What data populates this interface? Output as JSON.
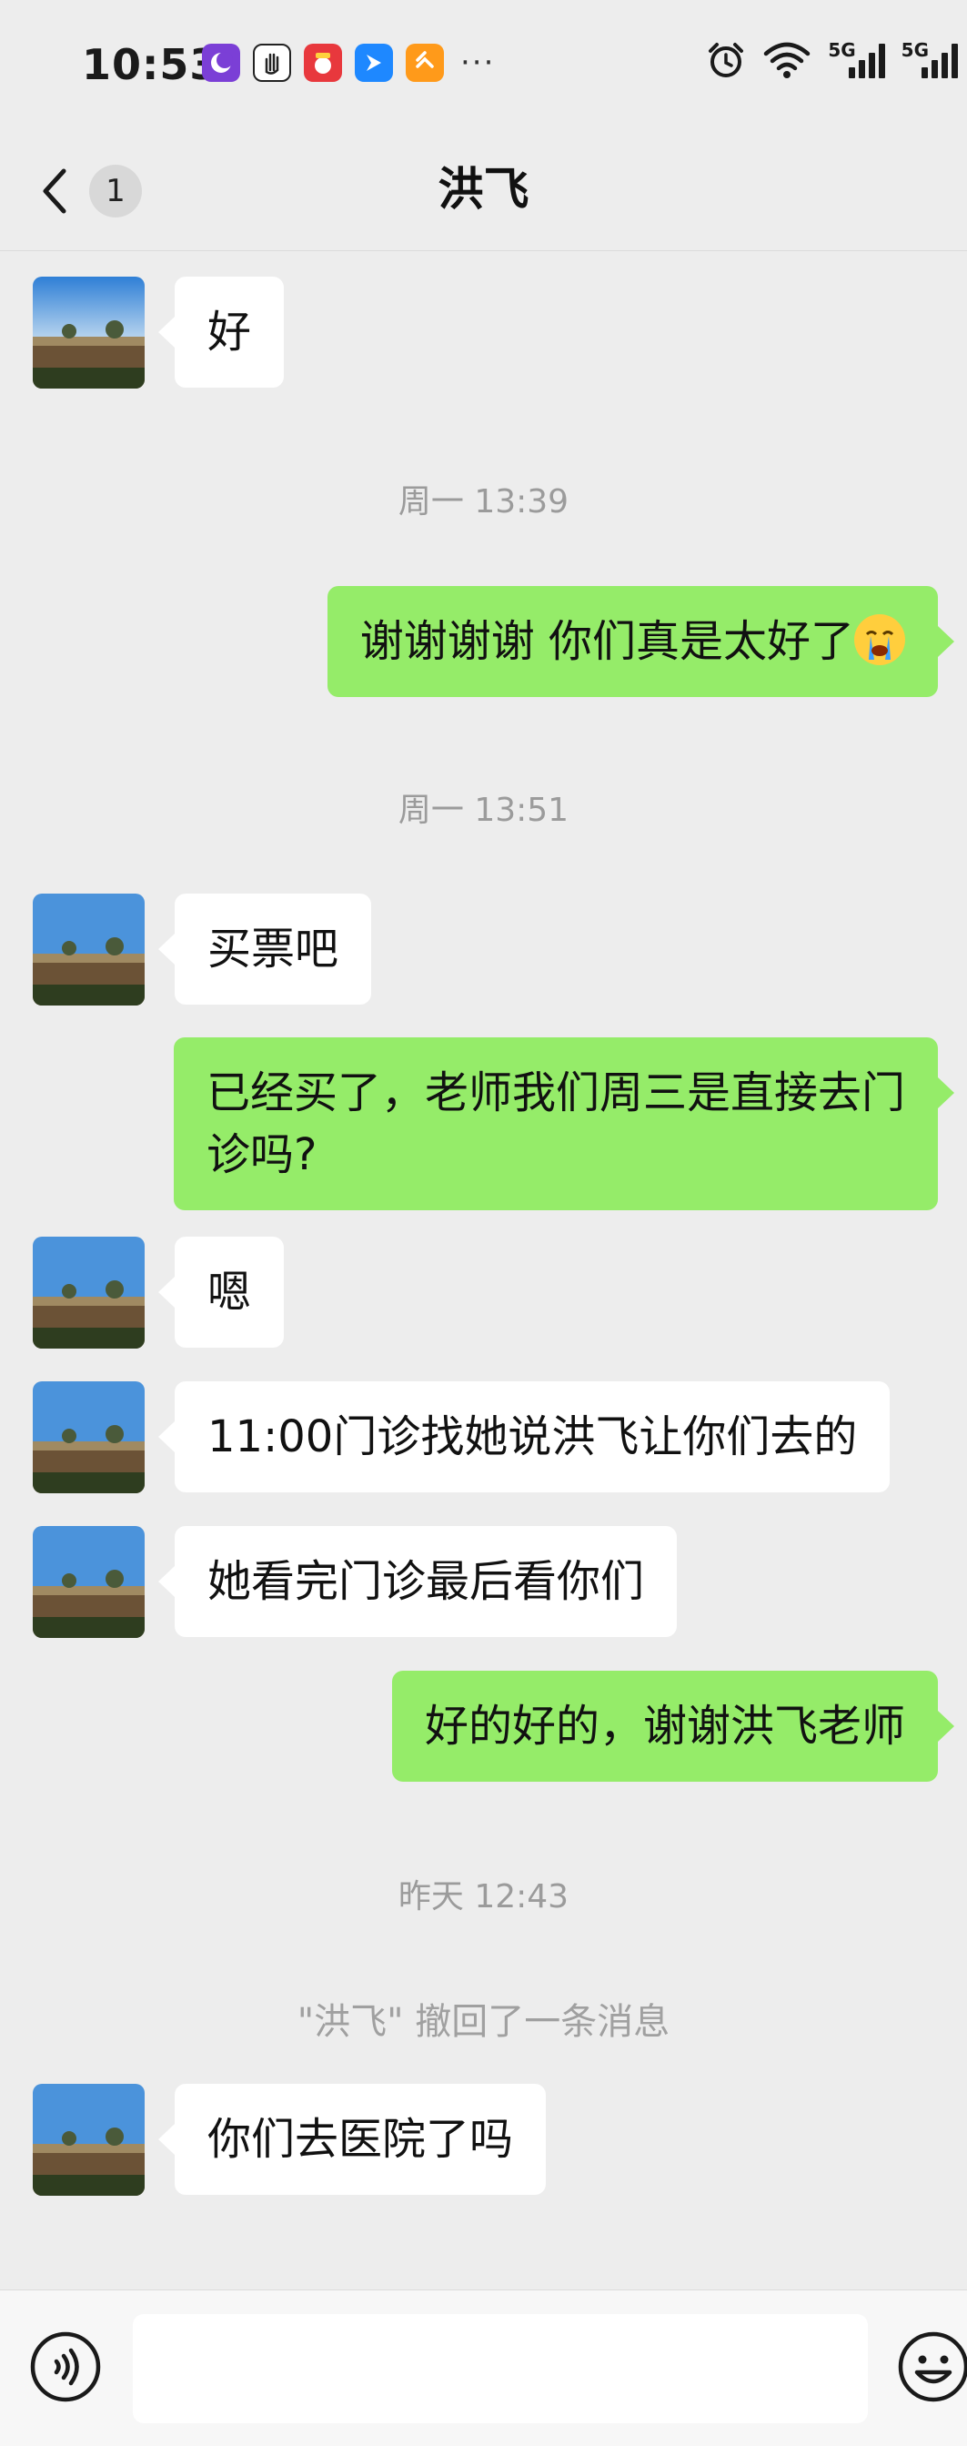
{
  "status_bar": {
    "time": "10:53",
    "apps": [
      {
        "icon": "moon-app-icon",
        "color": "#7b3fd6"
      },
      {
        "icon": "hand-app-icon",
        "color": "#ffffff"
      },
      {
        "icon": "buy-app-icon",
        "color": "#e8383d"
      },
      {
        "icon": "feishu-app-icon",
        "color": "#1e88ff"
      },
      {
        "icon": "orange-app-icon",
        "color": "#ff9a1a"
      }
    ],
    "more": "···",
    "network_1": "5G",
    "network_2": "5G"
  },
  "navbar": {
    "unread_count": "1",
    "title": "洪飞"
  },
  "messages": [
    {
      "type": "in",
      "text": "好"
    },
    {
      "type": "time",
      "text": "周一 13:39"
    },
    {
      "type": "out",
      "text": "谢谢谢谢 你们真是太好了"
    },
    {
      "type": "time",
      "text": "周一 13:51"
    },
    {
      "type": "in",
      "text": "买票吧"
    },
    {
      "type": "out",
      "text": "已经买了，老师我们周三是直接去门诊吗?"
    },
    {
      "type": "in",
      "text": "嗯"
    },
    {
      "type": "in",
      "text": "11:00门诊找她说洪飞让你们去的"
    },
    {
      "type": "in",
      "text": "她看完门诊最后看你们"
    },
    {
      "type": "out",
      "text": "好的好的，谢谢洪飞老师"
    },
    {
      "type": "time",
      "text": "昨天 12:43"
    },
    {
      "type": "system",
      "text": "\"洪飞\" 撤回了一条消息"
    },
    {
      "type": "in",
      "text": "你们去医院了吗"
    }
  ],
  "input": {
    "value": ""
  },
  "colors": {
    "background": "#ededed",
    "outgoing_bubble": "#95ec69",
    "incoming_bubble": "#ffffff"
  }
}
